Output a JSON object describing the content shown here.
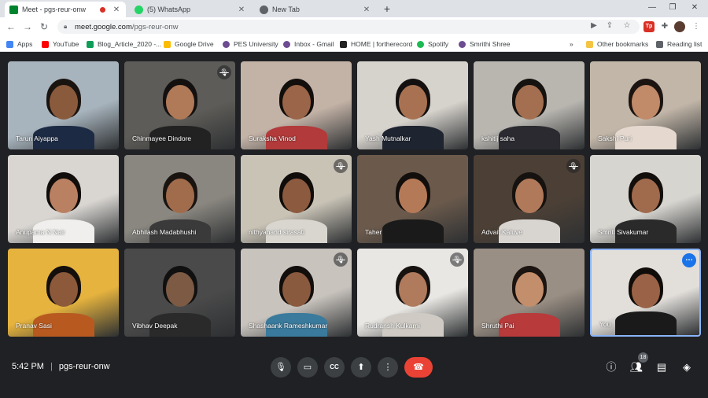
{
  "tabs": [
    {
      "label": "Meet - pgs-reur-onw",
      "active": true,
      "recording": true
    },
    {
      "label": "(5) WhatsApp",
      "active": false
    },
    {
      "label": "New Tab",
      "active": false
    }
  ],
  "address": {
    "host": "meet.google.com",
    "path": "/pgs-reur-onw"
  },
  "bookmarks": [
    {
      "label": "Apps",
      "color": "#4285f4"
    },
    {
      "label": "YouTube",
      "color": "#ff0000"
    },
    {
      "label": "Blog_Article_2020 -...",
      "color": "#0f9d58"
    },
    {
      "label": "Google Drive",
      "color": "#fbbc04"
    },
    {
      "label": "PES University",
      "color": "#6d4c91"
    },
    {
      "label": "Inbox - Gmail",
      "color": "#6d4c91"
    },
    {
      "label": "HOME | fortherecord",
      "color": "#222222"
    },
    {
      "label": "Spotify",
      "color": "#1db954"
    },
    {
      "label": "Smrithi Shree",
      "color": "#6d4c91"
    }
  ],
  "bookmarks_right": {
    "more": "»",
    "other": "Other bookmarks",
    "reading": "Reading list"
  },
  "participants": [
    {
      "name": "Tarun Aiyappa",
      "muted": false,
      "bg": "#a8b4bd",
      "skin": "#8a5a3c",
      "shirt": "#1c2a44",
      "hair": "#1a1410"
    },
    {
      "name": "Chinmayee Dindore",
      "muted": true,
      "bg": "#5e5c58",
      "skin": "#b07a58",
      "shirt": "#222222",
      "hair": "#141010"
    },
    {
      "name": "Suraksha Vinod",
      "muted": false,
      "bg": "#c3b2a6",
      "skin": "#9a6548",
      "shirt": "#b23a3a",
      "hair": "#120e0c"
    },
    {
      "name": "Yash Mutnalkar",
      "muted": false,
      "bg": "#d6d2cc",
      "skin": "#a87252",
      "shirt": "#1e2430",
      "hair": "#141010"
    },
    {
      "name": "kshitij saha",
      "muted": false,
      "bg": "#b9b6b0",
      "skin": "#a36f50",
      "shirt": "#2a2a30",
      "hair": "#161210"
    },
    {
      "name": "Sakshi Puri",
      "muted": false,
      "bg": "#c2b6a8",
      "skin": "#c18a68",
      "shirt": "#e5d9cf",
      "hair": "#1c1410"
    },
    {
      "name": "Anupama N Nair",
      "muted": false,
      "bg": "#d9d6d2",
      "skin": "#b98062",
      "shirt": "#f0efed",
      "hair": "#110d0b"
    },
    {
      "name": "Abhilash Madabhushi",
      "muted": false,
      "bg": "#8a8780",
      "skin": "#a06c4c",
      "shirt": "#3a3a3a",
      "hair": "#1a1410"
    },
    {
      "name": "nithyanand sirasati",
      "muted": true,
      "bg": "#c9c3b6",
      "skin": "#8c5a3e",
      "shirt": "#d9d6cf",
      "hair": "#100c0a"
    },
    {
      "name": "Taher",
      "muted": false,
      "bg": "#6b5a4c",
      "skin": "#b47a58",
      "shirt": "#1a1a1a",
      "hair": "#120e0c"
    },
    {
      "name": "Advait Kaluve",
      "muted": true,
      "bg": "#4c4036",
      "skin": "#b07a5a",
      "shirt": "#d8d4d0",
      "hair": "#161210"
    },
    {
      "name": "Smriti Sivakumar",
      "muted": false,
      "bg": "#d7d5d0",
      "skin": "#a06a4c",
      "shirt": "#2a2a2a",
      "hair": "#120e0c"
    },
    {
      "name": "Pranav Sasi",
      "muted": false,
      "bg": "#e6b33e",
      "skin": "#8c5a3a",
      "shirt": "#b85a20",
      "hair": "#140f0c"
    },
    {
      "name": "Vibhav Deepak",
      "muted": false,
      "bg": "#4a4a4a",
      "skin": "#7c5a44",
      "shirt": "#2a2a2a",
      "hair": "#101010"
    },
    {
      "name": "Shashaank Rameshkumar",
      "muted": true,
      "bg": "#c8c3bd",
      "skin": "#8a5a3e",
      "shirt": "#3a7a9c",
      "hair": "#120e0c"
    },
    {
      "name": "Rudransh Kulkarni",
      "muted": true,
      "bg": "#e9e7e3",
      "skin": "#b07a5c",
      "shirt": "#cfcbc4",
      "hair": "#161210"
    },
    {
      "name": "Shruthi Pai",
      "muted": false,
      "bg": "#9a8f84",
      "skin": "#c38e6c",
      "shirt": "#b83a3a",
      "hair": "#1c1410"
    },
    {
      "name": "You",
      "muted": false,
      "you": true,
      "bg": "#e2dfdb",
      "skin": "#9a6246",
      "shirt": "#1a1a1a",
      "hair": "#100c0a"
    }
  ],
  "meeting": {
    "time": "5:42 PM",
    "sep": "|",
    "code": "pgs-reur-onw"
  },
  "controls": {
    "participants_count": "18"
  },
  "icons": {
    "mic": "microphone-icon",
    "camera": "camera-icon",
    "cc": "captions-icon",
    "present": "present-icon",
    "more": "more-options-icon",
    "end": "end-call-icon",
    "info": "info-icon",
    "people": "people-icon",
    "chat": "chat-icon",
    "activities": "activities-icon"
  }
}
